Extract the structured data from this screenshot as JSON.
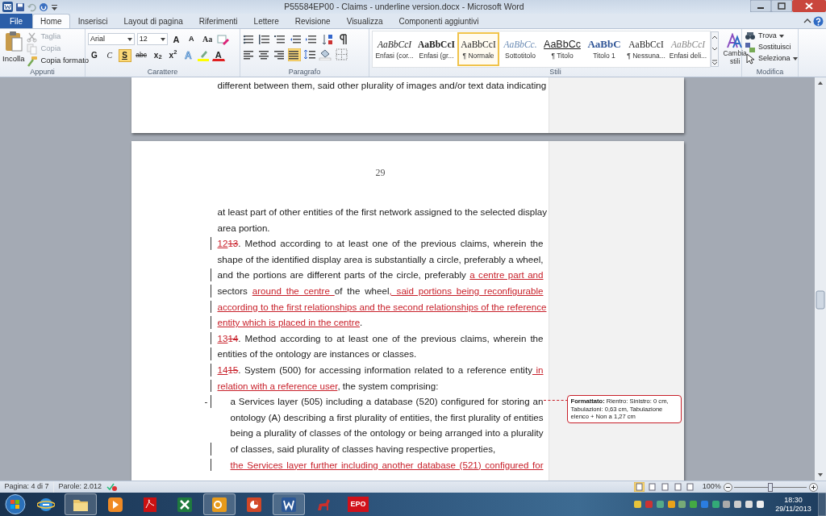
{
  "window": {
    "title": "P55584EP00 - Claims - underline version.docx - Microsoft Word"
  },
  "tabs": [
    {
      "label": "File",
      "kind": "file",
      "selected": false
    },
    {
      "label": "Home",
      "kind": "tab",
      "selected": true
    },
    {
      "label": "Inserisci",
      "kind": "tab",
      "selected": false
    },
    {
      "label": "Layout di pagina",
      "kind": "tab",
      "selected": false
    },
    {
      "label": "Riferimenti",
      "kind": "tab",
      "selected": false
    },
    {
      "label": "Lettere",
      "kind": "tab",
      "selected": false
    },
    {
      "label": "Revisione",
      "kind": "tab",
      "selected": false
    },
    {
      "label": "Visualizza",
      "kind": "tab",
      "selected": false
    },
    {
      "label": "Componenti aggiuntivi",
      "kind": "tab",
      "selected": false
    }
  ],
  "clipboard": {
    "group": "Appunti",
    "paste": "Incolla",
    "items": [
      {
        "label": "Taglia",
        "disabled": true
      },
      {
        "label": "Copia",
        "disabled": true
      },
      {
        "label": "Copia formato",
        "disabled": false
      }
    ]
  },
  "font": {
    "group": "Carattere",
    "name": "Arial",
    "size": "12",
    "grow": "A",
    "shrink": "A",
    "case": "Aa",
    "effects": "A",
    "font_color_label": "A",
    "formats": [
      {
        "label": "G",
        "kind": "bold",
        "selected": false
      },
      {
        "label": "C",
        "kind": "italic",
        "selected": false
      },
      {
        "label": "S",
        "kind": "underline",
        "selected": true
      },
      {
        "label": "abc",
        "kind": "strike",
        "selected": false
      },
      {
        "label": "x$_{2}$",
        "kind": "script",
        "selected": false
      },
      {
        "label": "x$^{2}$",
        "kind": "script",
        "selected": false
      }
    ]
  },
  "paragraph": {
    "group": "Paragrafo",
    "alignments": [
      {
        "selected": false
      },
      {
        "selected": false
      },
      {
        "selected": false
      },
      {
        "selected": true
      }
    ]
  },
  "styles": {
    "group": "Stili",
    "change_styles": "Cambia stili",
    "items": [
      {
        "preview": "AaBbCcI",
        "label": "Enfasi (cor...",
        "kind": "emphasis",
        "selected": false
      },
      {
        "preview": "AaBbCcI",
        "label": "Enfasi (gr...",
        "kind": "strong",
        "selected": false
      },
      {
        "preview": "AaBbCcI",
        "label": "¶ Normale",
        "kind": "normal",
        "selected": true
      },
      {
        "preview": "AaBbCc.",
        "label": "Sottotitolo",
        "kind": "subtitle",
        "selected": false
      },
      {
        "preview": "AaBbCc",
        "label": "¶ Titolo",
        "kind": "title",
        "selected": false
      },
      {
        "preview": "AaBbC",
        "label": "Titolo 1",
        "kind": "heading",
        "selected": false
      },
      {
        "preview": "AaBbCcI",
        "label": "¶ Nessuna...",
        "kind": "normal",
        "selected": false
      },
      {
        "preview": "AaBbCcI",
        "label": "Enfasi deli...",
        "kind": "subtle",
        "selected": false
      }
    ]
  },
  "editing": {
    "group": "Modifica",
    "items": [
      {
        "label": "Trova",
        "dropdown": true
      },
      {
        "label": "Sostituisci",
        "dropdown": false
      },
      {
        "label": "Seleziona",
        "dropdown": true
      }
    ]
  },
  "document": {
    "prev_page_line": "different between them, said other plurality of images and/or text data indicating",
    "page_number": "29",
    "paragraphs": [
      {
        "kind": "text",
        "lines": [
          {
            "changed": false,
            "runs": [
              {
                "text": "at least part of other entities of the first network assigned to the selected display",
                "kind": "plain"
              }
            ]
          },
          {
            "changed": false,
            "runs": [
              {
                "text": "area portion.",
                "kind": "plain"
              }
            ]
          }
        ]
      },
      {
        "kind": "text",
        "lines": [
          {
            "changed": true,
            "runs": [
              {
                "text": "12",
                "kind": "ins"
              },
              {
                "text": "13",
                "kind": "del"
              },
              {
                "text": ". Method according to at least one of the previous claims, wherein the",
                "kind": "plain"
              }
            ]
          },
          {
            "changed": false,
            "runs": [
              {
                "text": "shape of the identified display area is substantially a circle, preferably a wheel,",
                "kind": "plain"
              }
            ]
          },
          {
            "changed": true,
            "runs": [
              {
                "text": "and the portions are different parts of the circle, preferably ",
                "kind": "plain"
              },
              {
                "text": "a centre part and",
                "kind": "ins"
              }
            ]
          },
          {
            "changed": true,
            "runs": [
              {
                "text": "sectors ",
                "kind": "plain"
              },
              {
                "text": "around the centre ",
                "kind": "ins"
              },
              {
                "text": "of the wheel",
                "kind": "plain"
              },
              {
                "text": ", said portions being reconfigurable",
                "kind": "ins"
              }
            ]
          },
          {
            "changed": true,
            "runs": [
              {
                "text": "according to the first relationships and the second relationships of the reference",
                "kind": "ins"
              }
            ]
          },
          {
            "changed": true,
            "runs": [
              {
                "text": "entity which is placed in the centre",
                "kind": "ins"
              },
              {
                "text": ".",
                "kind": "plain"
              }
            ]
          }
        ]
      },
      {
        "kind": "text",
        "lines": [
          {
            "changed": true,
            "runs": [
              {
                "text": "13",
                "kind": "ins"
              },
              {
                "text": "14",
                "kind": "del"
              },
              {
                "text": ". Method according to at least one of the previous claims, wherein the",
                "kind": "plain"
              }
            ]
          },
          {
            "changed": true,
            "runs": [
              {
                "text": "entities of the ontology are instances or classes.",
                "kind": "plain"
              }
            ]
          }
        ]
      },
      {
        "kind": "text",
        "lines": [
          {
            "changed": true,
            "runs": [
              {
                "text": "14",
                "kind": "ins"
              },
              {
                "text": "15",
                "kind": "del"
              },
              {
                "text": ". System (500) for accessing information related to a reference entity",
                "kind": "plain"
              },
              {
                "text": " in",
                "kind": "ins"
              }
            ]
          },
          {
            "changed": true,
            "runs": [
              {
                "text": "relation with a reference user",
                "kind": "ins"
              },
              {
                "text": ", the system comprising:",
                "kind": "plain"
              }
            ]
          }
        ]
      },
      {
        "kind": "list",
        "marker": "-",
        "lines": [
          {
            "changed": true,
            "runs": [
              {
                "text": "a Services layer (505) including a database (520) configured for storing an",
                "kind": "plain"
              }
            ]
          },
          {
            "changed": false,
            "runs": [
              {
                "text": "ontology (A) describing a first plurality of entities, the first plurality of entities",
                "kind": "plain"
              }
            ]
          },
          {
            "changed": false,
            "runs": [
              {
                "text": "being a plurality of classes of the ontology or being arranged into a plurality",
                "kind": "plain"
              }
            ]
          },
          {
            "changed": true,
            "runs": [
              {
                "text": "of classes, said plurality of classes having respective properties,",
                "kind": "plain"
              }
            ]
          }
        ]
      },
      {
        "kind": "continuation",
        "lines": [
          {
            "changed": true,
            "runs": [
              {
                "text": "the Services layer further including another database (521) configured for",
                "kind": "ins"
              }
            ]
          }
        ]
      }
    ],
    "balloon": "**Formattato:** Rientro: Sinistro:  0 cm, Tabulazioni:  0,63 cm, Tabulazione elenco + Non a  1,27 cm"
  },
  "status_bar": {
    "page": "Pagina: 4 di 7",
    "words": "Parole: 2.012",
    "views": [
      {
        "selected": true
      },
      {
        "selected": false
      },
      {
        "selected": false
      },
      {
        "selected": false
      },
      {
        "selected": false
      }
    ],
    "zoom": "100%",
    "zoom_slider": {
      "level": 0.5
    }
  },
  "taskbar": {
    "apps": [
      {
        "kind": "ie",
        "running": false
      },
      {
        "kind": "folder",
        "running": true
      },
      {
        "kind": "media",
        "running": false
      },
      {
        "kind": "pdf",
        "running": false
      },
      {
        "kind": "excel",
        "running": false
      },
      {
        "kind": "outlook",
        "running": true
      },
      {
        "kind": "powerpoint",
        "running": false
      },
      {
        "kind": "word",
        "running": true
      },
      {
        "kind": "horse",
        "running": false
      },
      {
        "kind": "epo",
        "label": "EPO",
        "running": false
      }
    ],
    "time": "18:30",
    "date": "29/11/2013"
  }
}
